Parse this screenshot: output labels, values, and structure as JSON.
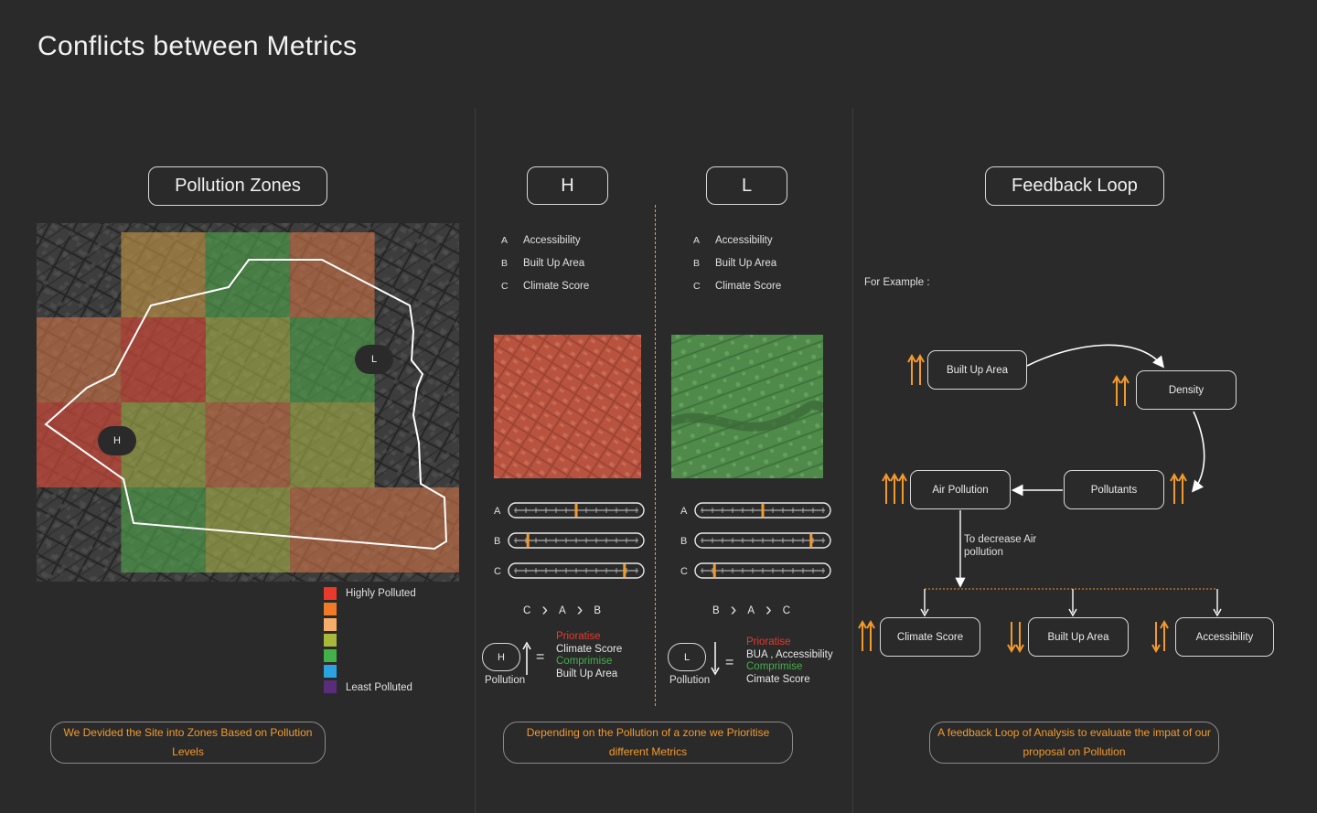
{
  "page_title": "Conflicts between Metrics",
  "zones": {
    "title": "Pollution Zones",
    "h_marker": "H",
    "l_marker": "L",
    "legend": {
      "high_label": "Highly Polluted",
      "low_label": "Least Polluted",
      "colors": [
        "#e8392a",
        "#f07a28",
        "#f5ad6a",
        "#a8b83a",
        "#43b14a",
        "#2ba3e0",
        "#5a2d7a"
      ]
    },
    "note": "We Devided the Site into Zones Based on Pollution Levels"
  },
  "metrics": {
    "h": {
      "title": "H",
      "items": [
        {
          "key": "A",
          "label": "Accessibility"
        },
        {
          "key": "B",
          "label": "Built Up Area"
        },
        {
          "key": "C",
          "label": "Climate Score"
        }
      ],
      "sliders": [
        {
          "key": "A",
          "level": 0.5
        },
        {
          "key": "B",
          "level": 0.1
        },
        {
          "key": "C",
          "level": 0.9
        }
      ],
      "order": [
        "C",
        "A",
        "B"
      ],
      "badge": "H",
      "badge_caption": "Pollution",
      "equals": "=",
      "prioritise_label": "Prioratise",
      "prioritise_value": "Climate Score",
      "compromise_label": "Comprimise",
      "compromise_value": "Built Up Area"
    },
    "l": {
      "title": "L",
      "items": [
        {
          "key": "A",
          "label": "Accessibility"
        },
        {
          "key": "B",
          "label": "Built Up Area"
        },
        {
          "key": "C",
          "label": "Climate Score"
        }
      ],
      "sliders": [
        {
          "key": "A",
          "level": 0.5
        },
        {
          "key": "B",
          "level": 0.9
        },
        {
          "key": "C",
          "level": 0.1
        }
      ],
      "order": [
        "B",
        "A",
        "C"
      ],
      "badge": "L",
      "badge_caption": "Pollution",
      "equals": "=",
      "prioritise_label": "Prioratise",
      "prioritise_value": "BUA , Accessibility",
      "compromise_label": "Comprimise",
      "compromise_value": "Cimate Score"
    },
    "note": "Depending on the Pollution of a zone we Prioritise different Metrics"
  },
  "feedback": {
    "title": "Feedback Loop",
    "example_label": "For Example :",
    "nodes": {
      "built_up": "Built Up Area",
      "density": "Density",
      "air_pollution": "Air Pollution",
      "pollutants": "Pollutants",
      "climate_score": "Climate Score",
      "built_up_area": "Built Up Area",
      "accessibility": "Accessibility"
    },
    "decrease_label": "To decrease Air pollution",
    "note": "A feedback Loop of Analysis to evaluate the impat of our proposal on Pollution"
  },
  "colors": {
    "accent": "#f39a2c",
    "prioritise": "#e8392a",
    "compromise": "#43b14a",
    "background": "#2a2a2a"
  }
}
